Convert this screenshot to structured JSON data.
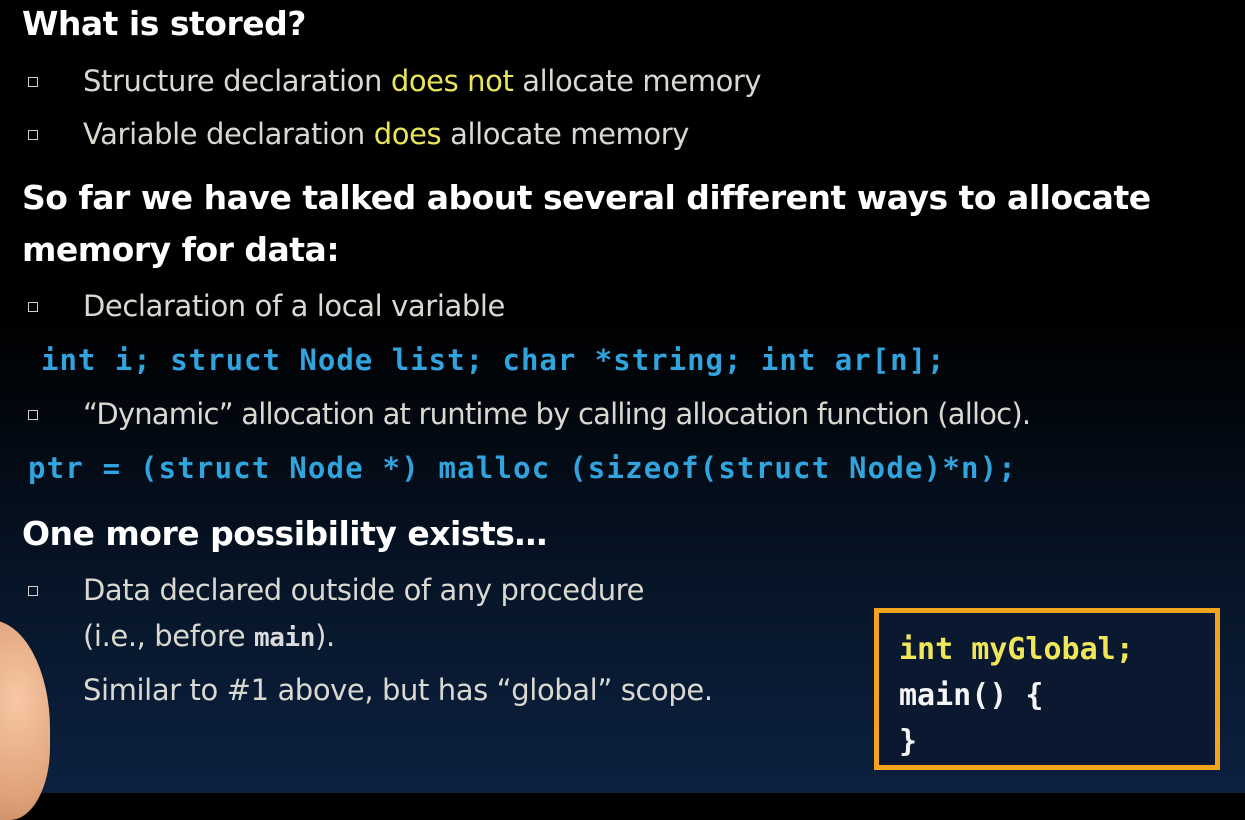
{
  "slide": {
    "heading1": "What is stored?",
    "bullets1": [
      {
        "before": "Structure declaration ",
        "highlight": "does not",
        "after": " allocate memory"
      },
      {
        "before": "Variable declaration ",
        "highlight": "does",
        "after": " allocate memory"
      }
    ],
    "heading2_line1": "So far we have talked about several different ways to allocate",
    "heading2_line2": "memory for data:",
    "bullets2": [
      {
        "text": "Declaration of a local variable"
      },
      {
        "text": "“Dynamic” allocation at runtime by calling allocation function (alloc)."
      }
    ],
    "code1": "int i; struct Node list; char *string; int ar[n];",
    "code2": "ptr = (struct Node *) malloc (sizeof(struct Node)*n);",
    "heading3": "One more possibility exists…",
    "bullets3": [
      {
        "line1": "Data declared outside of any procedure",
        "line2_before": "(i.e., before ",
        "line2_code": "main",
        "line2_after": ")."
      },
      {
        "text": "Similar to #1 above, but has “global” scope."
      }
    ],
    "code_box": {
      "line1": "int myGlobal;",
      "line2": "main() {",
      "line3": "}"
    }
  },
  "colors": {
    "heading": "#ffffff",
    "body_text": "#d9d9d2",
    "highlight": "#e8e55a",
    "code": "#31a3dd",
    "box_border": "#f2a41f",
    "box_code_yellow": "#f0e65a"
  }
}
